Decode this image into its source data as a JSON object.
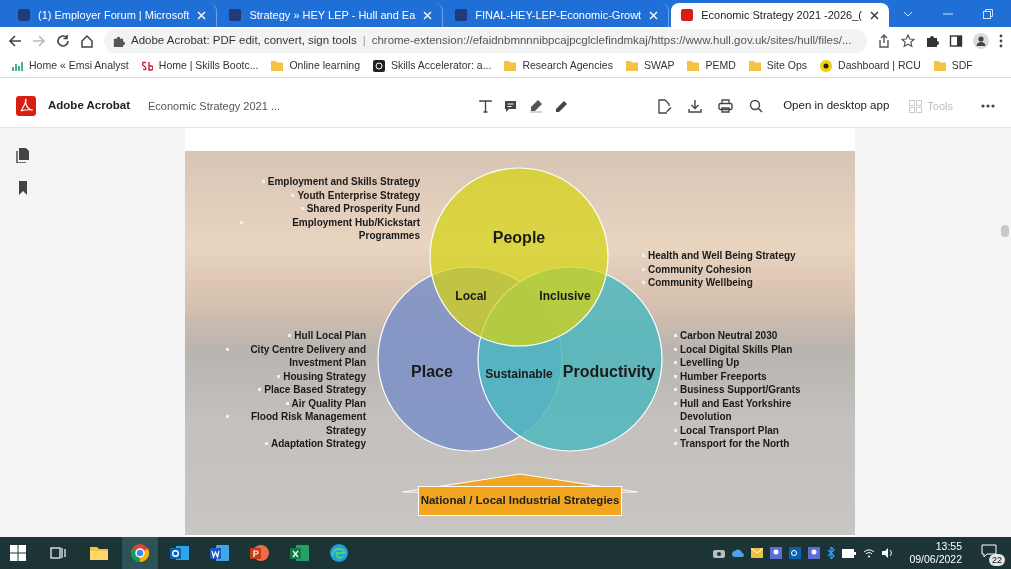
{
  "browser": {
    "tabs": [
      {
        "title": "(1) Employer Forum | Microsoft",
        "selected": false
      },
      {
        "title": "Strategy » HEY LEP - Hull and Ea",
        "selected": false
      },
      {
        "title": "FINAL-HEY-LEP-Economic-Growt",
        "selected": false
      },
      {
        "title": "Economic Strategy 2021 -2026_(",
        "selected": true
      }
    ],
    "address_bar": {
      "site_name": "Adobe Acrobat: PDF edit, convert, sign tools",
      "separator": "|",
      "url": "chrome-extension://efaidnbmnnnibpcajpcglclefindmkaj/https://www.hull.gov.uk/sites/hull/files/..."
    },
    "bookmarks": [
      {
        "label": "Home « Emsi Analyst",
        "kind": "chart"
      },
      {
        "label": "Home | Skills Bootc...",
        "kind": "sb"
      },
      {
        "label": "Online learning",
        "kind": "folder"
      },
      {
        "label": "Skills Accelerator: a...",
        "kind": "badge"
      },
      {
        "label": "Research Agencies",
        "kind": "folder"
      },
      {
        "label": "SWAP",
        "kind": "folder"
      },
      {
        "label": "PEMD",
        "kind": "folder"
      },
      {
        "label": "Site Ops",
        "kind": "folder"
      },
      {
        "label": "Dashboard | RCU",
        "kind": "dot"
      },
      {
        "label": "SDF",
        "kind": "folder"
      }
    ]
  },
  "acrobat": {
    "app_name": "Adobe Acrobat",
    "document_title": "Economic Strategy 2021 ...",
    "open_button": "Open in desktop app",
    "tools_button": {
      "label": "Tools",
      "disabled": true
    }
  },
  "page": {
    "venn": {
      "circles": [
        "People",
        "Place",
        "Productivity"
      ],
      "overlaps": [
        "Local",
        "Inclusive",
        "Sustainable"
      ]
    },
    "lists": [
      {
        "items": [
          "Employment and Skills Strategy",
          "Youth Enterprise Strategy",
          "Shared Prosperity Fund",
          "Employment Hub/Kickstart Programmes"
        ]
      },
      {
        "items": [
          "Hull Local Plan",
          "City Centre Delivery and Investment Plan",
          "Housing Strategy",
          "Place Based Strategy",
          "Air Quality Plan",
          "Flood Risk Management Strategy",
          "Adaptation Strategy"
        ]
      },
      {
        "items": [
          "Health and Well Being Strategy",
          "Community Cohesion",
          "Community Wellbeing"
        ]
      },
      {
        "items": [
          "Carbon Neutral 2030",
          "Local Digital Skills Plan",
          "Levelling Up",
          "Humber Freeports",
          "Business Support/Grants",
          "Hull and East Yorkshire Devolution",
          "Local Transport Plan",
          "Transport for the North"
        ]
      }
    ],
    "banner": "National / Local Industrial Strategies"
  },
  "taskbar": {
    "time": "13:55",
    "date": "09/06/2022",
    "notifications": "22"
  }
}
